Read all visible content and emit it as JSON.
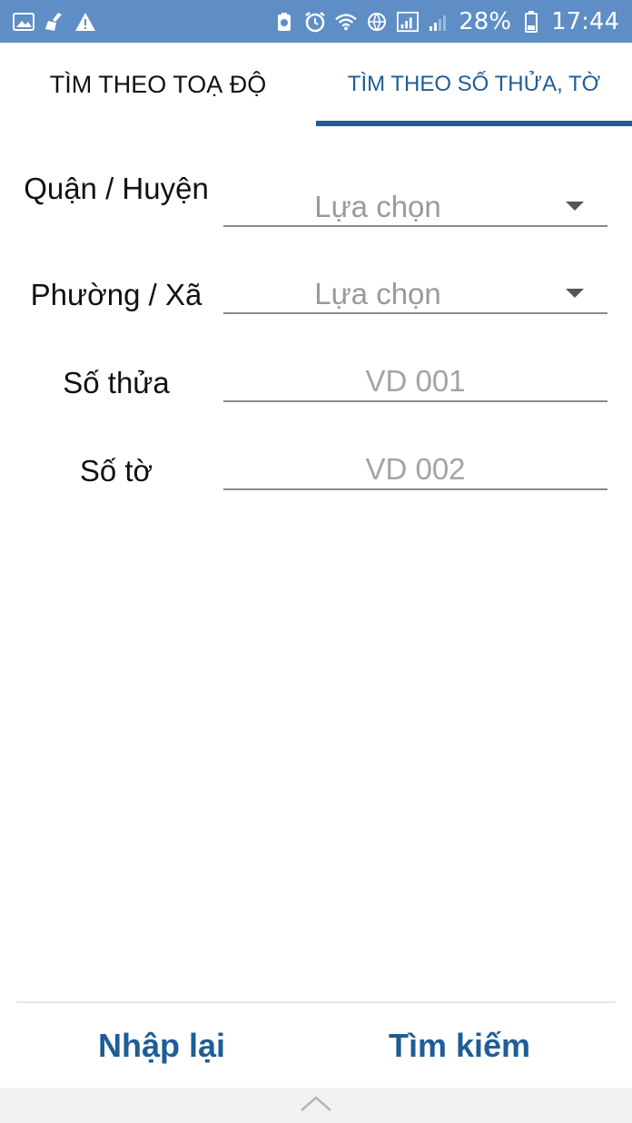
{
  "status_bar": {
    "battery": "28%",
    "time": "17:44",
    "icons_left": [
      "image-icon",
      "cleaner-icon",
      "warning-icon"
    ],
    "icons_right": [
      "battery-saver-icon",
      "alarm-icon",
      "wifi-icon",
      "globe-icon",
      "signal-icon",
      "signal-icon-2",
      "battery-icon"
    ]
  },
  "tabs": [
    {
      "label": "TÌM THEO TOẠ ĐỘ",
      "active": false
    },
    {
      "label": "TÌM THEO SỐ THỬA, TỜ",
      "active": true
    }
  ],
  "form": {
    "district": {
      "label": "Quận / Huyện",
      "value": "Lựa chọn"
    },
    "ward": {
      "label": "Phường / Xã",
      "value": "Lựa chọn"
    },
    "parcel": {
      "label": "Số thửa",
      "placeholder": "VD 001"
    },
    "sheet": {
      "label": "Số tờ",
      "placeholder": "VD 002"
    }
  },
  "actions": {
    "reset_label": "Nhập lại",
    "search_label": "Tìm kiếm"
  },
  "colors": {
    "status_bar": "#5e8ec5",
    "accent": "#1f5d96"
  }
}
